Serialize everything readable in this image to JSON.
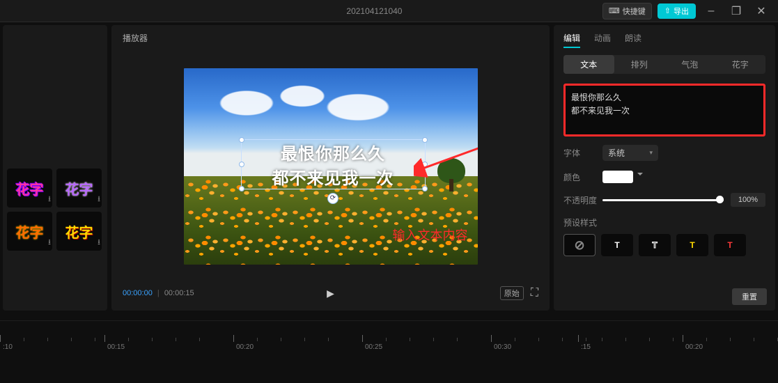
{
  "titlebar": {
    "project_name": "202104121040",
    "shortcut_label": "快捷键",
    "export_label": "导出"
  },
  "thumbs": {
    "label": "花字"
  },
  "player": {
    "title": "播放器",
    "current_time": "00:00:00",
    "total_time": "00:00:15",
    "ratio_label": "原始",
    "text_line1": "最恨你那么久",
    "text_line2": "都不来见我一次",
    "annotation": "输入文本内容"
  },
  "right_panel": {
    "tabs": {
      "edit": "编辑",
      "anim": "动画",
      "read": "朗读"
    },
    "subtabs": {
      "text": "文本",
      "arrange": "排列",
      "bubble": "气泡",
      "fancy": "花字"
    },
    "text_input": "最恨你那么久\n都不来见我一次",
    "font_label": "字体",
    "font_value": "系统",
    "color_label": "颜色",
    "opacity_label": "不透明度",
    "opacity_value": "100%",
    "preset_label": "预设样式",
    "reset_label": "重置"
  },
  "timeline": {
    "ticks": [
      {
        "pos": 0,
        "label": ":10"
      },
      {
        "pos": 150,
        "label": "00:15"
      },
      {
        "pos": 335,
        "label": "00:20"
      },
      {
        "pos": 520,
        "label": "00:25"
      },
      {
        "pos": 705,
        "label": "00:30"
      },
      {
        "pos": 830,
        "label": ":15"
      },
      {
        "pos": 980,
        "label": "00:20"
      }
    ]
  },
  "chart_data": null
}
